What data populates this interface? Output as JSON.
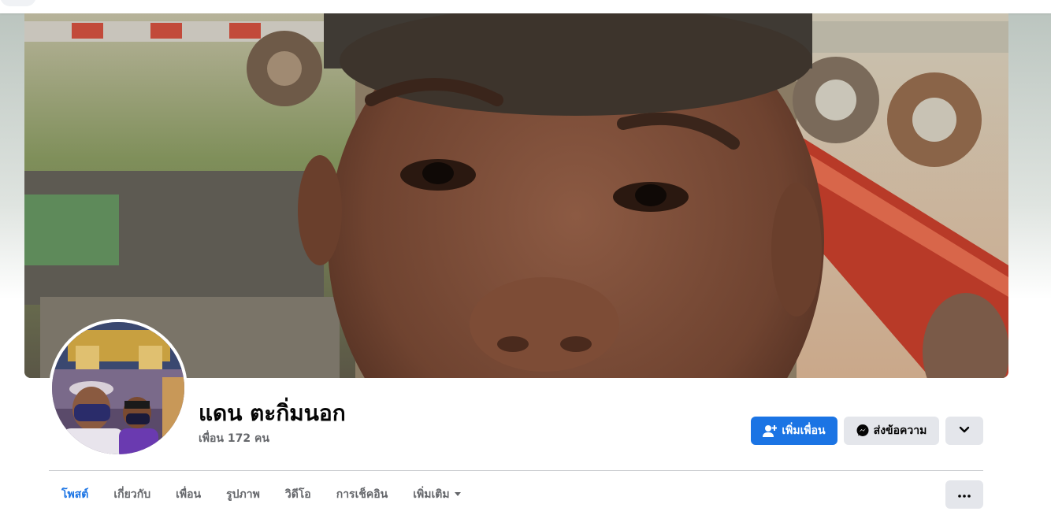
{
  "profile": {
    "name": "แดน ตะกิ่มนอก",
    "friends_label": "เพื่อน 172 คน"
  },
  "actions": {
    "add_friend": "เพิ่มเพื่อน",
    "message": "ส่งข้อความ"
  },
  "tabs": [
    {
      "label": "โพสต์",
      "active": true
    },
    {
      "label": "เกี่ยวกับ",
      "active": false
    },
    {
      "label": "เพื่อน",
      "active": false
    },
    {
      "label": "รูปภาพ",
      "active": false
    },
    {
      "label": "วิดีโอ",
      "active": false
    },
    {
      "label": "การเช็คอิน",
      "active": false
    },
    {
      "label": "เพิ่มเติม",
      "active": false
    }
  ],
  "icons": {
    "add_friend": "person-plus-icon",
    "message": "messenger-icon",
    "chevron": "chevron-down-icon",
    "more": "more-horizontal-icon",
    "tab_more_caret": "caret-down-icon"
  },
  "colors": {
    "accent": "#1b74e4",
    "secondary_button": "#e4e6eb",
    "text_primary": "#050505",
    "text_secondary": "#65676b"
  }
}
